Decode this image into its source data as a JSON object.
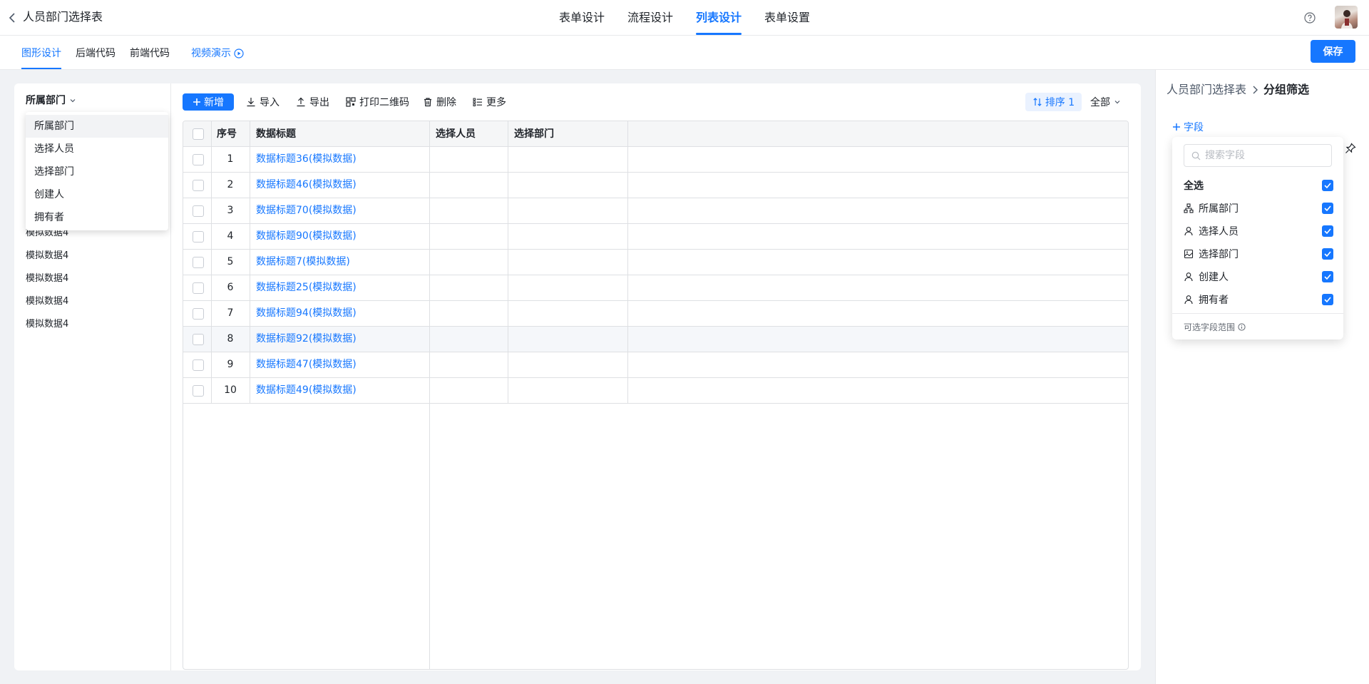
{
  "header": {
    "title": "人员部门选择表",
    "main_tabs": [
      {
        "label": "表单设计",
        "active": false
      },
      {
        "label": "流程设计",
        "active": false
      },
      {
        "label": "列表设计",
        "active": true
      },
      {
        "label": "表单设置",
        "active": false
      }
    ]
  },
  "subbar": {
    "tabs": [
      {
        "label": "图形设计",
        "active": true
      },
      {
        "label": "后端代码",
        "active": false
      },
      {
        "label": "前端代码",
        "active": false
      }
    ],
    "video_demo": "视频演示",
    "save_label": "保存"
  },
  "left_panel": {
    "group_field": "所属部门",
    "dropdown_options": [
      "所属部门",
      "选择人员",
      "选择部门",
      "创建人",
      "拥有者"
    ],
    "dropdown_selected": "所属部门",
    "items": [
      "模拟数据4",
      "模拟数据4",
      "模拟数据4",
      "模拟数据4",
      "模拟数据4"
    ]
  },
  "toolbar": {
    "add_label": "新增",
    "import_label": "导入",
    "export_label": "导出",
    "print_qr_label": "打印二维码",
    "delete_label": "删除",
    "more_label": "更多",
    "sort_label": "排序 1",
    "scope_label": "全部"
  },
  "table": {
    "columns": [
      "序号",
      "数据标题",
      "选择人员",
      "选择部门"
    ],
    "rows": [
      {
        "index": "1",
        "title": "数据标题36(模拟数据)",
        "person": "",
        "dept": ""
      },
      {
        "index": "2",
        "title": "数据标题46(模拟数据)",
        "person": "",
        "dept": ""
      },
      {
        "index": "3",
        "title": "数据标题70(模拟数据)",
        "person": "",
        "dept": ""
      },
      {
        "index": "4",
        "title": "数据标题90(模拟数据)",
        "person": "",
        "dept": ""
      },
      {
        "index": "5",
        "title": "数据标题7(模拟数据)",
        "person": "",
        "dept": ""
      },
      {
        "index": "6",
        "title": "数据标题25(模拟数据)",
        "person": "",
        "dept": ""
      },
      {
        "index": "7",
        "title": "数据标题94(模拟数据)",
        "person": "",
        "dept": ""
      },
      {
        "index": "8",
        "title": "数据标题92(模拟数据)",
        "person": "",
        "dept": ""
      },
      {
        "index": "9",
        "title": "数据标题47(模拟数据)",
        "person": "",
        "dept": ""
      },
      {
        "index": "10",
        "title": "数据标题49(模拟数据)",
        "person": "",
        "dept": ""
      }
    ],
    "hovered_row": 8
  },
  "right_panel": {
    "breadcrumb_parent": "人员部门选择表",
    "breadcrumb_current": "分组筛选",
    "add_field_label": "字段",
    "picker": {
      "search_placeholder": "搜索字段",
      "select_all_label": "全选",
      "fields": [
        {
          "label": "所属部门",
          "icon": "org-icon",
          "checked": true
        },
        {
          "label": "选择人员",
          "icon": "person-icon",
          "checked": true
        },
        {
          "label": "选择部门",
          "icon": "dept-icon",
          "checked": true
        },
        {
          "label": "创建人",
          "icon": "person-icon",
          "checked": true
        },
        {
          "label": "拥有者",
          "icon": "person-icon",
          "checked": true
        }
      ],
      "footer_label": "可选字段范围"
    }
  },
  "colors": {
    "accent": "#1677ff",
    "text": "#1f2329",
    "border": "#dee0e3",
    "page_bg": "#f0f2f5"
  }
}
